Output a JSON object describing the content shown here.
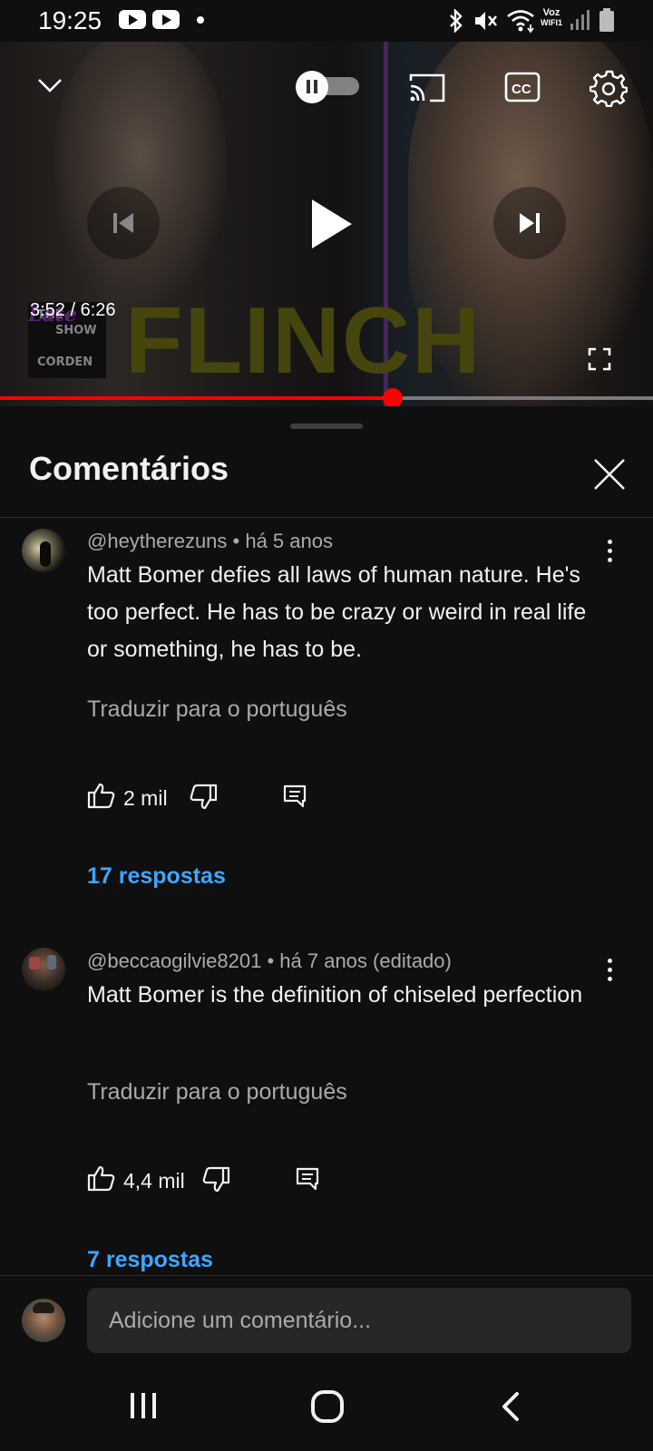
{
  "status_bar": {
    "time": "19:25",
    "voz": "Voz",
    "wifi_label": "WIFI1",
    "icons": [
      "youtube-icon",
      "youtube-icon",
      "notification-dot",
      "bluetooth-icon",
      "mute-icon",
      "wifi-icon",
      "signal-icon",
      "battery-icon"
    ]
  },
  "player": {
    "current_time": "3:52 / 6:26",
    "progress": 0.602,
    "overlay_title": "FLINCH",
    "show_logo": {
      "line1": "THE",
      "line2": "SHOW",
      "line3": "CORDEN",
      "script": "Late"
    },
    "controls": [
      "collapse-icon",
      "pause-toggle",
      "cast-icon",
      "captions-icon",
      "settings-icon",
      "previous-icon",
      "play-icon",
      "next-icon",
      "fullscreen-icon"
    ]
  },
  "comments_panel": {
    "title": "Comentários",
    "close_icon": "close-icon",
    "comments": [
      {
        "meta": "@heytherezuns • há 5 anos",
        "text": "Matt Bomer defies all laws of human nature. He's too perfect. He has to be crazy or weird in real life or something, he has to be.",
        "translate": "Traduzir para o português",
        "likes": "2 mil",
        "replies": "17 respostas"
      },
      {
        "meta": "@beccaogilvie8201 • há 7 anos (editado)",
        "text": "Matt Bomer is the definition of chiseled perfection",
        "translate": "Traduzir para o português",
        "likes": "4,4 mil",
        "replies": "7 respostas"
      }
    ],
    "input_placeholder": "Adicione um comentário..."
  },
  "colors": {
    "accent": "#ff0000",
    "link": "#3ea6ff",
    "background": "#0f0f0f",
    "muted": "#aaaaaa"
  }
}
